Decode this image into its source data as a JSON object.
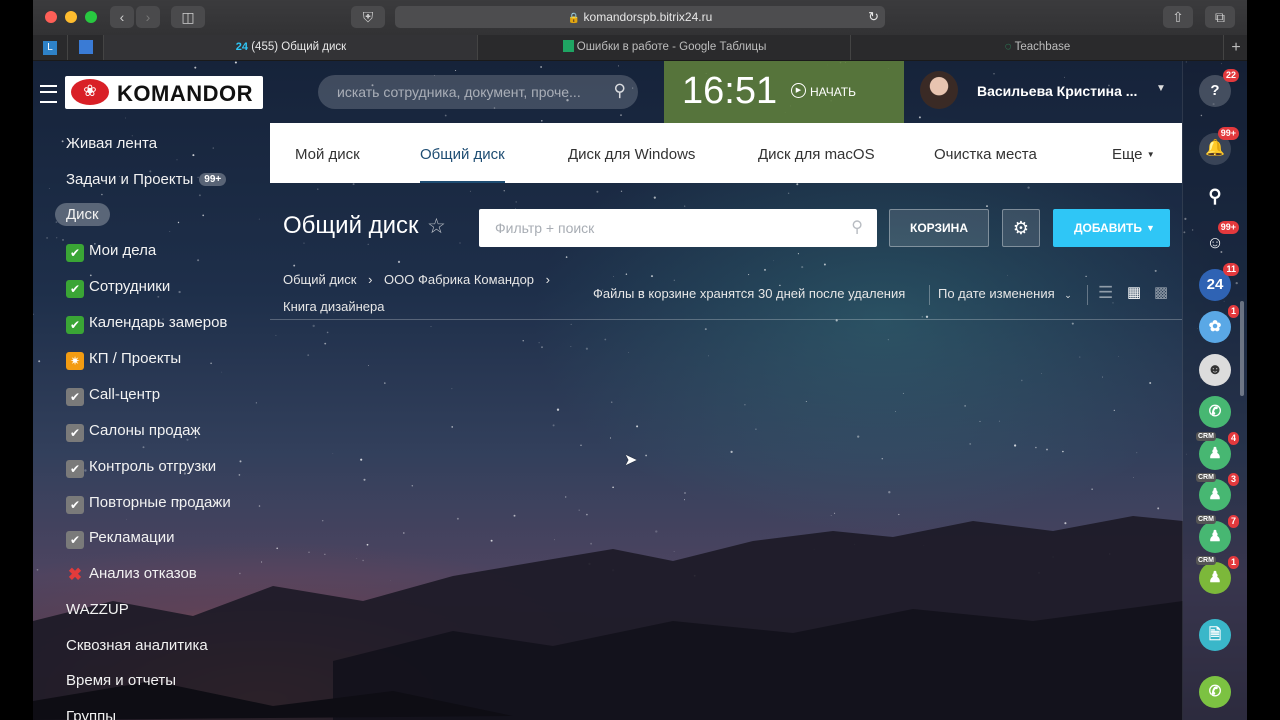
{
  "browser": {
    "url": "komandorspb.bitrix24.ru",
    "tabs": [
      {
        "label": "(455) Общий диск"
      },
      {
        "label": "Ошибки в работе - Google Таблицы"
      },
      {
        "label": "Teachbase"
      }
    ]
  },
  "header": {
    "logo_text": "KOMANDOR",
    "search_placeholder": "искать сотрудника, документ, проче...",
    "clock": "16:51",
    "start_label": "НАЧАТЬ",
    "user_name": "Васильева Кристина ..."
  },
  "sidebar": {
    "items": [
      {
        "label": "Живая лента"
      },
      {
        "label": "Задачи и Проекты",
        "badge": "99+"
      },
      {
        "label": "Диск"
      },
      {
        "label": "Мои дела",
        "icon": "✔"
      },
      {
        "label": "Сотрудники",
        "icon": "✔"
      },
      {
        "label": "Календарь замеров",
        "icon": "✔"
      },
      {
        "label": "КП / Проекты",
        "icon": "✷"
      },
      {
        "label": "Call-центр",
        "icon": "✔"
      },
      {
        "label": "Салоны продаж",
        "icon": "✔"
      },
      {
        "label": "Контроль отгрузки",
        "icon": "✔"
      },
      {
        "label": "Повторные продажи",
        "icon": "✔"
      },
      {
        "label": "Рекламации",
        "icon": "✔"
      },
      {
        "label": "Анализ отказов",
        "icon": "✖"
      },
      {
        "label": "WAZZUP"
      },
      {
        "label": "Сквозная аналитика"
      },
      {
        "label": "Время и отчеты"
      },
      {
        "label": "Группы"
      }
    ]
  },
  "disk_tabs": [
    {
      "label": "Мой диск"
    },
    {
      "label": "Общий диск"
    },
    {
      "label": "Диск для Windows"
    },
    {
      "label": "Диск для macOS"
    },
    {
      "label": "Очистка места"
    },
    {
      "label": "Еще"
    }
  ],
  "toolbar": {
    "title": "Общий диск",
    "filter_placeholder": "Фильтр + поиск",
    "trash_label": "КОРЗИНА",
    "add_label": "ДОБАВИТЬ"
  },
  "breadcrumb": {
    "items": [
      "Общий диск",
      "ООО Фабрика Командор",
      "Книга дизайнера"
    ],
    "trash_note": "Файлы в корзине хранятся 30 дней после удаления",
    "sort_label": "По дате изменения"
  },
  "rail": {
    "badges": {
      "help": "22",
      "notify": "99+",
      "bot": "99+",
      "b24": "11",
      "app": "1",
      "crm1": "4",
      "crm2": "3",
      "crm3": "7",
      "crm4": "1"
    },
    "b24_label": "24",
    "crm_tag": "CRM"
  },
  "colors": {
    "accent": "#2fc6f6",
    "clock_bg": "#5c7a3c",
    "tab_active": "#1e4d73",
    "green": "#47b772"
  }
}
